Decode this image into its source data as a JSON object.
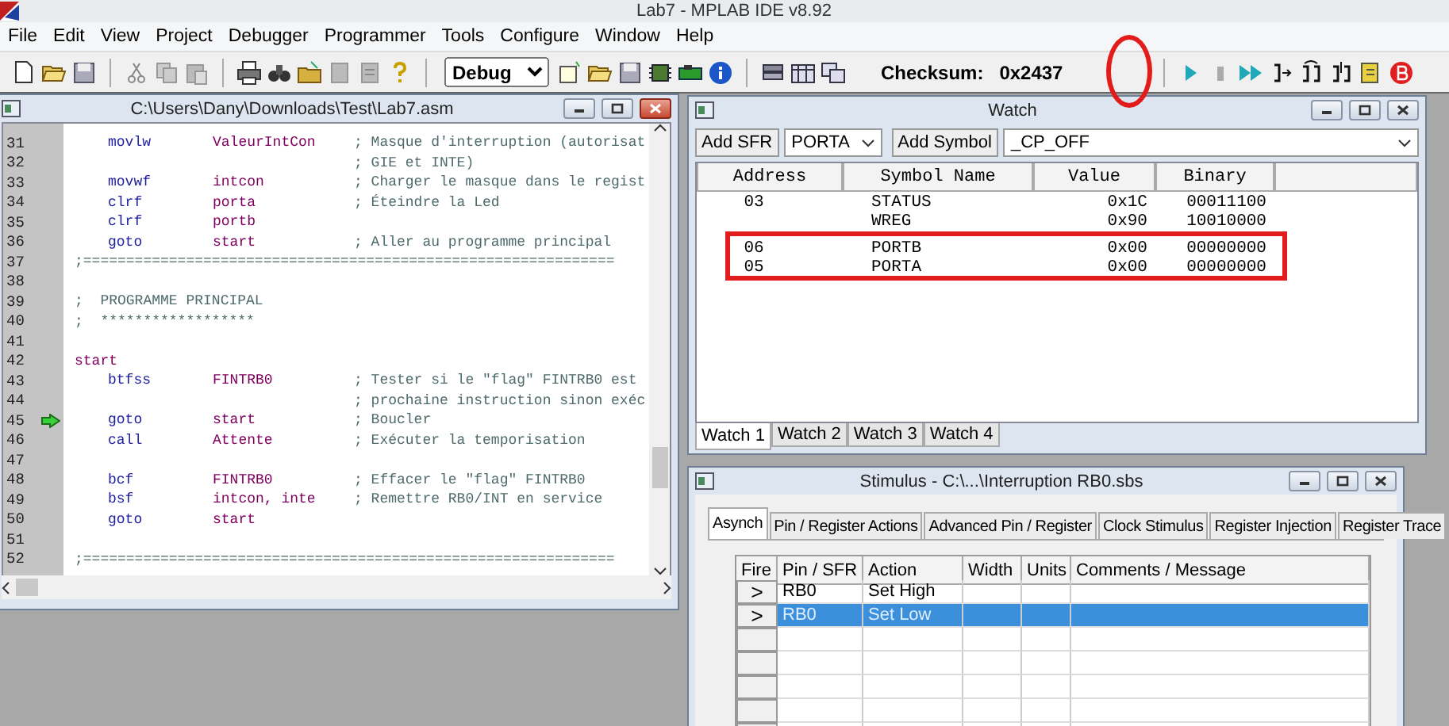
{
  "app": {
    "title": "Lab7 - MPLAB IDE v8.92"
  },
  "menu": [
    "File",
    "Edit",
    "View",
    "Project",
    "Debugger",
    "Programmer",
    "Tools",
    "Configure",
    "Window",
    "Help"
  ],
  "toolbar": {
    "configuration": "Debug",
    "checksum_label": "Checksum:",
    "checksum_value": "0x2437"
  },
  "editor": {
    "title": "C:\\Users\\Dany\\Downloads\\Test\\Lab7.asm",
    "active": true,
    "lines": [
      {
        "number": "31",
        "kind": "code",
        "current": false,
        "op": "movlw",
        "arg": "ValeurIntCon",
        "comment": "; Masque d'interruption (autorisat"
      },
      {
        "number": "32",
        "kind": "code",
        "current": false,
        "comment": "; GIE et INTE)"
      },
      {
        "number": "33",
        "kind": "code",
        "current": false,
        "op": "movwf",
        "arg": "intcon",
        "comment": "; Charger le masque dans le regist"
      },
      {
        "number": "34",
        "kind": "code",
        "current": false,
        "op": "clrf",
        "arg": "porta",
        "comment": "; Éteindre la Led"
      },
      {
        "number": "35",
        "kind": "code",
        "current": false,
        "op": "clrf",
        "arg": "portb"
      },
      {
        "number": "36",
        "kind": "code",
        "current": false,
        "op": "goto",
        "arg": "start",
        "comment": "; Aller au programme principal"
      },
      {
        "number": "37",
        "kind": "rule",
        "current": false,
        "text": ";=============================================================="
      },
      {
        "number": "38",
        "kind": "blank",
        "current": false
      },
      {
        "number": "39",
        "kind": "comment",
        "current": false,
        "text": ";  PROGRAMME PRINCIPAL"
      },
      {
        "number": "40",
        "kind": "comment",
        "current": false,
        "text": ";  ******************"
      },
      {
        "number": "41",
        "kind": "blank",
        "current": false
      },
      {
        "number": "42",
        "kind": "label",
        "current": false,
        "text": "start"
      },
      {
        "number": "43",
        "kind": "code",
        "current": false,
        "op": "btfss",
        "arg": "FINTRB0",
        "comment": "; Tester si le \"flag\" FINTRB0 est"
      },
      {
        "number": "44",
        "kind": "code",
        "current": false,
        "comment": "; prochaine instruction sinon exéc"
      },
      {
        "number": "45",
        "kind": "code",
        "current": true,
        "op": "goto",
        "arg": "start",
        "comment": "; Boucler"
      },
      {
        "number": "46",
        "kind": "code",
        "current": false,
        "op": "call",
        "arg": "Attente",
        "comment": "; Exécuter la temporisation"
      },
      {
        "number": "47",
        "kind": "blank",
        "current": false
      },
      {
        "number": "48",
        "kind": "code",
        "current": false,
        "op": "bcf",
        "arg": "FINTRB0",
        "comment": "; Effacer le \"flag\" FINTRB0"
      },
      {
        "number": "49",
        "kind": "code",
        "current": false,
        "op": "bsf",
        "arg": "intcon, inte",
        "comment": "; Remettre RB0/INT en service"
      },
      {
        "number": "50",
        "kind": "code",
        "current": false,
        "op": "goto",
        "arg": "start"
      },
      {
        "number": "51",
        "kind": "blank",
        "current": false
      },
      {
        "number": "52",
        "kind": "rule",
        "current": false,
        "text": ";=============================================================="
      }
    ]
  },
  "watch": {
    "title": "Watch",
    "active": false,
    "add_sfr_button": "Add SFR",
    "sfr_select": "PORTA",
    "add_symbol_button": "Add Symbol",
    "symbol_select": "_CP_OFF",
    "columns": [
      "Address",
      "Symbol Name",
      "Value",
      "Binary"
    ],
    "rows": [
      {
        "address": "03",
        "symbol": "STATUS",
        "value": "0x1C",
        "binary": "00011100"
      },
      {
        "symbol": "WREG",
        "value": "0x90",
        "binary": "10010000"
      },
      {
        "address": "06",
        "symbol": "PORTB",
        "value": "0x00",
        "binary": "00000000"
      },
      {
        "address": "05",
        "symbol": "PORTA",
        "value": "0x00",
        "binary": "00000000"
      }
    ],
    "tabs": [
      {
        "label": "Watch 1",
        "selected": true
      },
      {
        "label": "Watch 2",
        "selected": false
      },
      {
        "label": "Watch 3",
        "selected": false
      },
      {
        "label": "Watch 4",
        "selected": false
      }
    ]
  },
  "stimulus": {
    "title": "Stimulus - C:\\...\\Interruption RB0.sbs",
    "active": false,
    "tabs": [
      {
        "label": "Asynch",
        "selected": true
      },
      {
        "label": "Pin / Register Actions",
        "selected": false
      },
      {
        "label": "Advanced Pin / Register",
        "selected": false
      },
      {
        "label": "Clock Stimulus",
        "selected": false
      },
      {
        "label": "Register Injection",
        "selected": false
      },
      {
        "label": "Register Trace",
        "selected": false
      }
    ],
    "columns": [
      "Fire",
      "Pin / SFR",
      "Action",
      "Width",
      "Units",
      "Comments / Message"
    ],
    "rows": [
      {
        "fire": ">",
        "pin": "RB0",
        "action": "Set High",
        "selected": false
      },
      {
        "fire": ">",
        "pin": "RB0",
        "action": "Set Low",
        "selected": true
      }
    ]
  }
}
